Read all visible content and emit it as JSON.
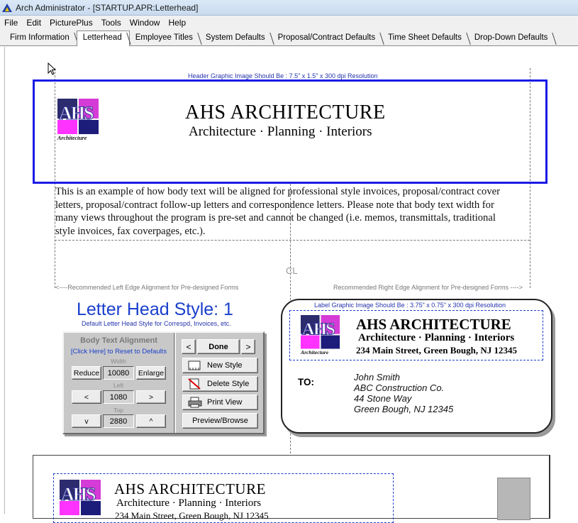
{
  "window": {
    "title": "Arch Administrator - [STARTUP.APR:Letterhead]"
  },
  "menu": [
    "File",
    "Edit",
    "PicturePlus",
    "Tools",
    "Window",
    "Help"
  ],
  "tabs": [
    {
      "label": "Firm Information",
      "active": false
    },
    {
      "label": "Letterhead",
      "active": true
    },
    {
      "label": "Employee Titles",
      "active": false
    },
    {
      "label": "System Defaults",
      "active": false
    },
    {
      "label": "Proposal/Contract Defaults",
      "active": false
    },
    {
      "label": "Time Sheet Defaults",
      "active": false
    },
    {
      "label": "Drop-Down Defaults",
      "active": false
    }
  ],
  "letterhead": {
    "header_note": "Header Graphic Image Should Be :  7.5\" x 1.5\" x  300 dpi Resolution",
    "logo_letters": "AHS",
    "logo_caption": "Architecture",
    "firm_name": "AHS ARCHITECTURE",
    "firm_tagline": "Architecture · Planning · Interiors",
    "body_text": "This is an example of how body text will be aligned for professional style invoices, proposal/contract cover letters, proposal/contract follow-up letters and correspondence letters.  Please note that body text width for many views throughout the program is pre-set and cannot be changed (i.e. memos, transmittals, traditional style invoices, fax coverpages, etc.).",
    "center_mark": "CL",
    "left_edge_note": "<----Recommended Left Edge Alignment for Pre-designed Forms",
    "right_edge_note": "Recommended Right Edge Alignment for Pre-designed Forms ---->"
  },
  "style": {
    "title": "Letter Head Style: 1",
    "subtitle": "Default Letter Head Style for Correspd, Invoices, etc."
  },
  "alignment_panel": {
    "title": "Body Text Alignment",
    "reset_link": "[Click Here] to Reset to Defaults",
    "width_label": "Width",
    "width_value": "10080",
    "reduce_label": "Reduce",
    "enlarge_label": "Enlarge",
    "left_label": "Left",
    "left_value": "1080",
    "left_dec": "<",
    "left_inc": ">",
    "top_label": "Top",
    "top_value": "2880",
    "top_dec": "v",
    "top_inc": "^",
    "prev": "<",
    "done": "Done",
    "next": ">",
    "new_style": "New Style",
    "delete_style": "Delete Style",
    "print_view": "Print View",
    "preview_browse": "Preview/Browse"
  },
  "label": {
    "note": "Label Graphic Image Should Be :  3.75\" x 0.75\" x  300 dpi Resolution",
    "firm_name": "AHS ARCHITECTURE",
    "tagline": "Architecture · Planning · Interiors",
    "address_line": "234 Main Street, Green Bough, NJ 12345",
    "to_label": "TO:",
    "recipient": [
      "John Smith",
      "ABC Construction Co.",
      "44 Stone Way",
      "Green Bough, NJ 12345"
    ]
  },
  "preview2": {
    "firm_name": "AHS ARCHITECTURE",
    "tagline": "Architecture · Planning · Interiors",
    "address_line": "234 Main Street, Green Bough, NJ 12345"
  },
  "colors": {
    "accent_blue": "#1a1ae6",
    "link_blue": "#1a3fcc",
    "logo_magenta": "#ff33ff",
    "logo_navy": "#1c1c7a"
  }
}
